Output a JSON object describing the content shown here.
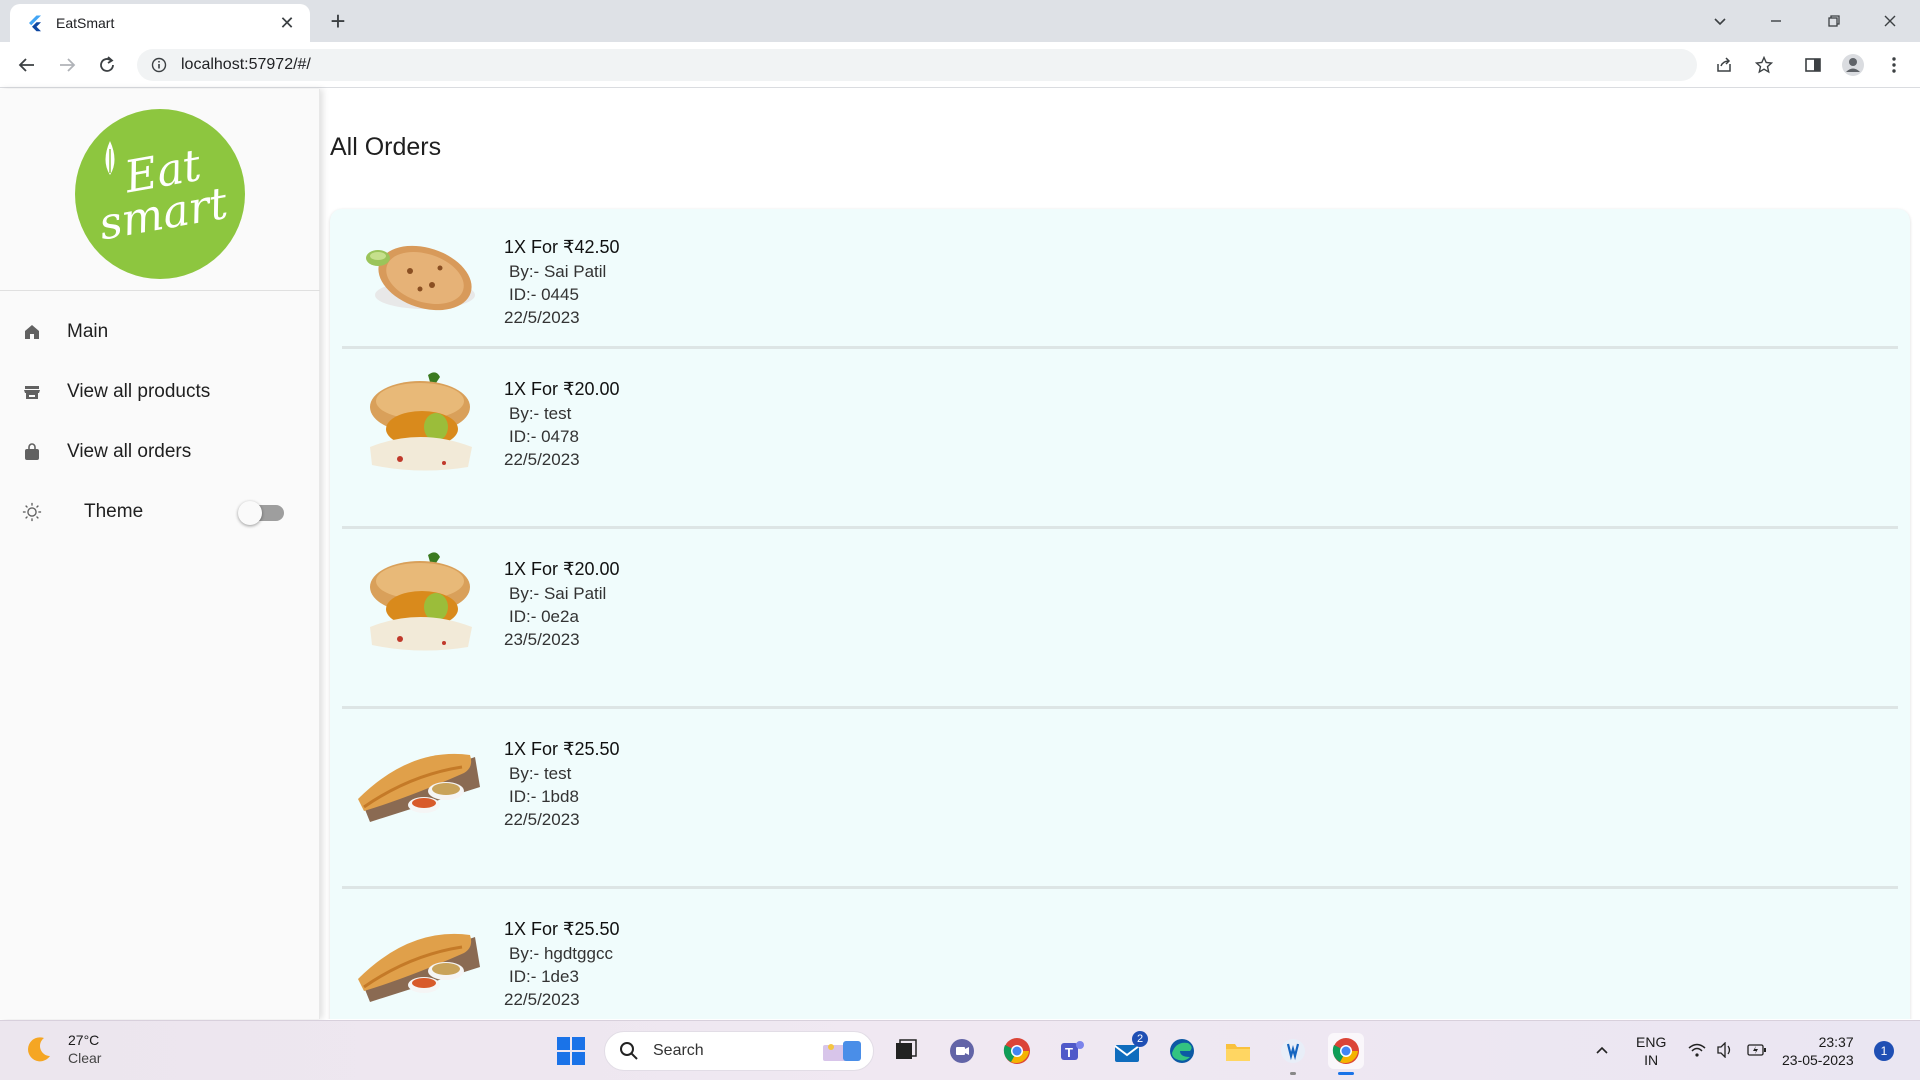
{
  "browser": {
    "tab_title": "EatSmart",
    "url": "localhost:57972/#/"
  },
  "sidebar": {
    "logo_line1": "Eat",
    "logo_line2": "smart",
    "items": [
      {
        "label": "Main",
        "icon": "home-icon"
      },
      {
        "label": "View all products",
        "icon": "store-icon"
      },
      {
        "label": "View all orders",
        "icon": "shopping-bag-icon"
      }
    ],
    "theme_label": "Theme",
    "theme_dark": false
  },
  "main": {
    "title": "All Orders",
    "orders": [
      {
        "price": "1X For ₹42.50",
        "by": "By:- Sai Patil",
        "id": "ID:- 0445",
        "date": "22/5/2023",
        "image": "paratha"
      },
      {
        "price": "1X For ₹20.00",
        "by": "By:- test",
        "id": "ID:- 0478",
        "date": "22/5/2023",
        "image": "vada-pav"
      },
      {
        "price": "1X For ₹20.00",
        "by": "By:- Sai Patil",
        "id": "ID:- 0e2a",
        "date": "23/5/2023",
        "image": "vada-pav"
      },
      {
        "price": "1X For ₹25.50",
        "by": "By:- test",
        "id": "ID:- 1bd8",
        "date": "22/5/2023",
        "image": "dosa"
      },
      {
        "price": "1X For ₹25.50",
        "by": "By:- hgdtggcc",
        "id": "ID:- 1de3",
        "date": "22/5/2023",
        "image": "dosa"
      }
    ]
  },
  "taskbar": {
    "temperature": "27°C",
    "condition": "Clear",
    "search_label": "Search",
    "mail_badge": "2",
    "lang_line1": "ENG",
    "lang_line2": "IN",
    "time": "23:37",
    "date": "23-05-2023",
    "notifications": "1"
  },
  "colors": {
    "logo_green": "#8dc63f",
    "order_bg": "#f0fcfc"
  }
}
